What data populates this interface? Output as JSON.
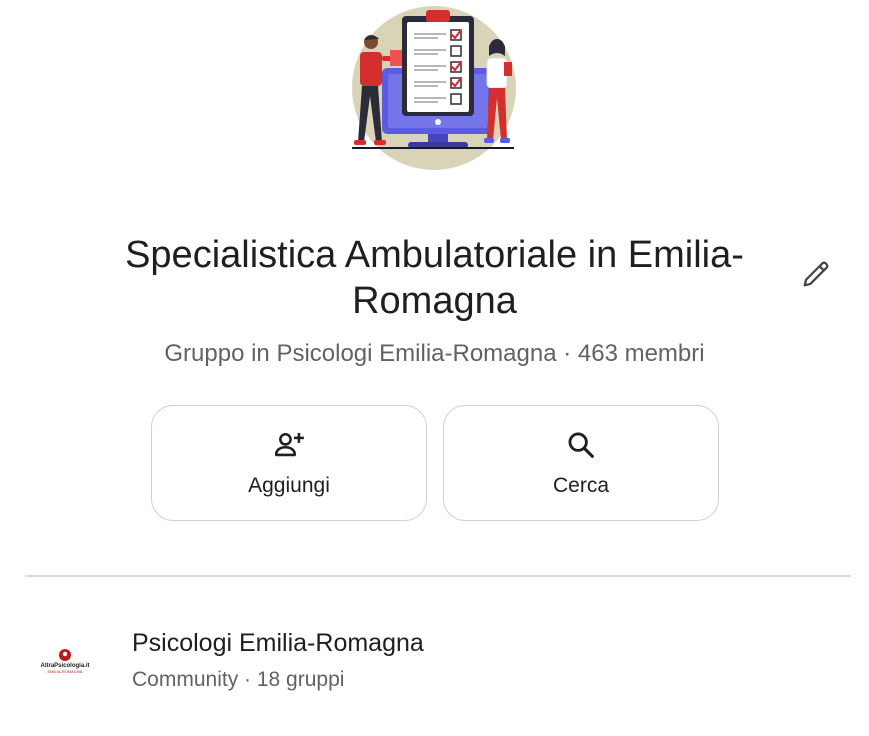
{
  "group": {
    "title": "Specialistica Ambulatoriale in Emilia-Romagna",
    "subtitle": "Gruppo in Psicologi Emilia-Romagna · 463 membri",
    "avatar_icon": "checklist-illustration-icon",
    "edit_icon": "pencil-icon"
  },
  "actions": [
    {
      "label": "Aggiungi",
      "icon": "add-person-icon"
    },
    {
      "label": "Cerca",
      "icon": "search-icon"
    }
  ],
  "community": {
    "name": "Psicologi Emilia-Romagna",
    "meta": "Community · 18 gruppi",
    "logo_text": "AltraPsicologia.it",
    "logo_subtext": "EMILIA-ROMAGNA"
  },
  "colors": {
    "text_primary": "#1f1f1f",
    "text_secondary": "#5f6368",
    "border": "#d0d0d0",
    "divider": "#dadce0",
    "avatar_bg": "#d9d3b8",
    "illustration_red": "#d32f2f",
    "illustration_purple": "#5c5ce0"
  }
}
